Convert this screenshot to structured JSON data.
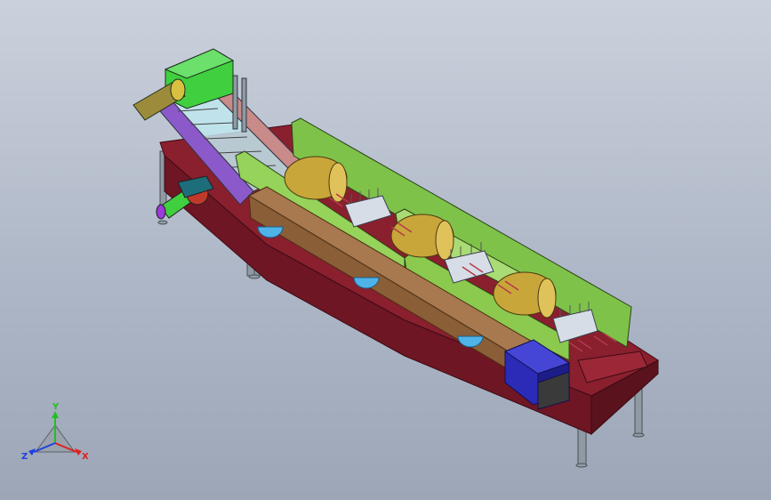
{
  "triad": {
    "x_label": "X",
    "y_label": "Y",
    "z_label": "Z",
    "x_color": "#e02020",
    "y_color": "#20c020",
    "z_color": "#2040e0"
  },
  "colors": {
    "background_top": "#cbd1dc",
    "background_bottom": "#9ca6b7",
    "frame_maroon": "#8a1f2e",
    "green_guard": "#7fc24a",
    "brown_rail": "#a8794e",
    "gold_drum": "#c9a63a",
    "blue_motor": "#2b2bb8",
    "gearbox_green": "#3fcf3f",
    "leg_gray": "#8f9aa3",
    "bubble_blue": "#4fb3e8"
  },
  "icons": {
    "triad": "coordinate-triad-icon"
  }
}
